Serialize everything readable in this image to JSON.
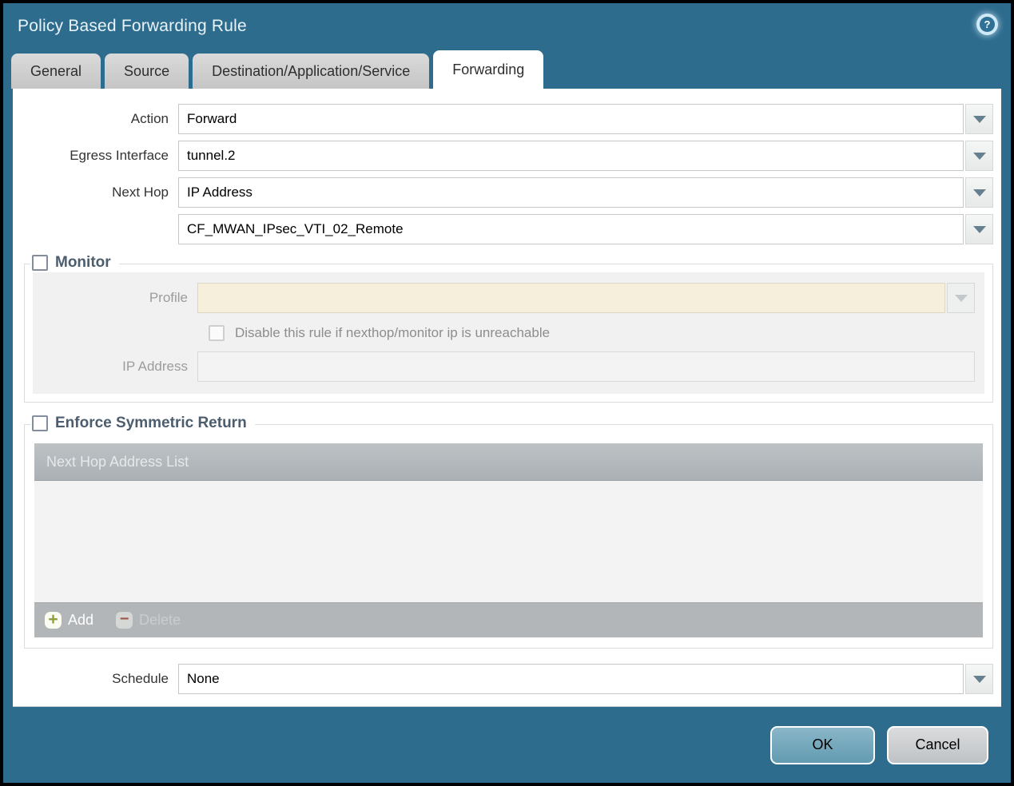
{
  "window": {
    "title": "Policy Based Forwarding Rule"
  },
  "icons": {
    "help": "?",
    "add": "+",
    "delete": "−"
  },
  "tabs": [
    {
      "label": "General",
      "active": false
    },
    {
      "label": "Source",
      "active": false
    },
    {
      "label": "Destination/Application/Service",
      "active": false
    },
    {
      "label": "Forwarding",
      "active": true
    }
  ],
  "form": {
    "action_label": "Action",
    "action_value": "Forward",
    "egress_label": "Egress Interface",
    "egress_value": "tunnel.2",
    "next_hop_label": "Next Hop",
    "next_hop_value": "IP Address",
    "next_hop_address_value": "CF_MWAN_IPsec_VTI_02_Remote",
    "schedule_label": "Schedule",
    "schedule_value": "None"
  },
  "monitor": {
    "title": "Monitor",
    "checked": false,
    "profile_label": "Profile",
    "profile_value": "",
    "disable_rule_label": "Disable this rule if nexthop/monitor ip is unreachable",
    "disable_rule_checked": false,
    "ip_address_label": "IP Address",
    "ip_address_value": ""
  },
  "enforce_symmetric_return": {
    "title": "Enforce Symmetric Return",
    "checked": false,
    "list_header": "Next Hop Address List",
    "rows": [],
    "add_label": "Add",
    "delete_label": "Delete"
  },
  "footer": {
    "ok_label": "OK",
    "cancel_label": "Cancel"
  },
  "colors": {
    "chrome": "#2e6c8e",
    "ok_button": "#6fa5ba",
    "cancel_button": "#c9cbcd",
    "disabled_field": "#f5efdc",
    "table_header": "#b3b8bb",
    "fieldset_title": "#4c5d6e"
  }
}
